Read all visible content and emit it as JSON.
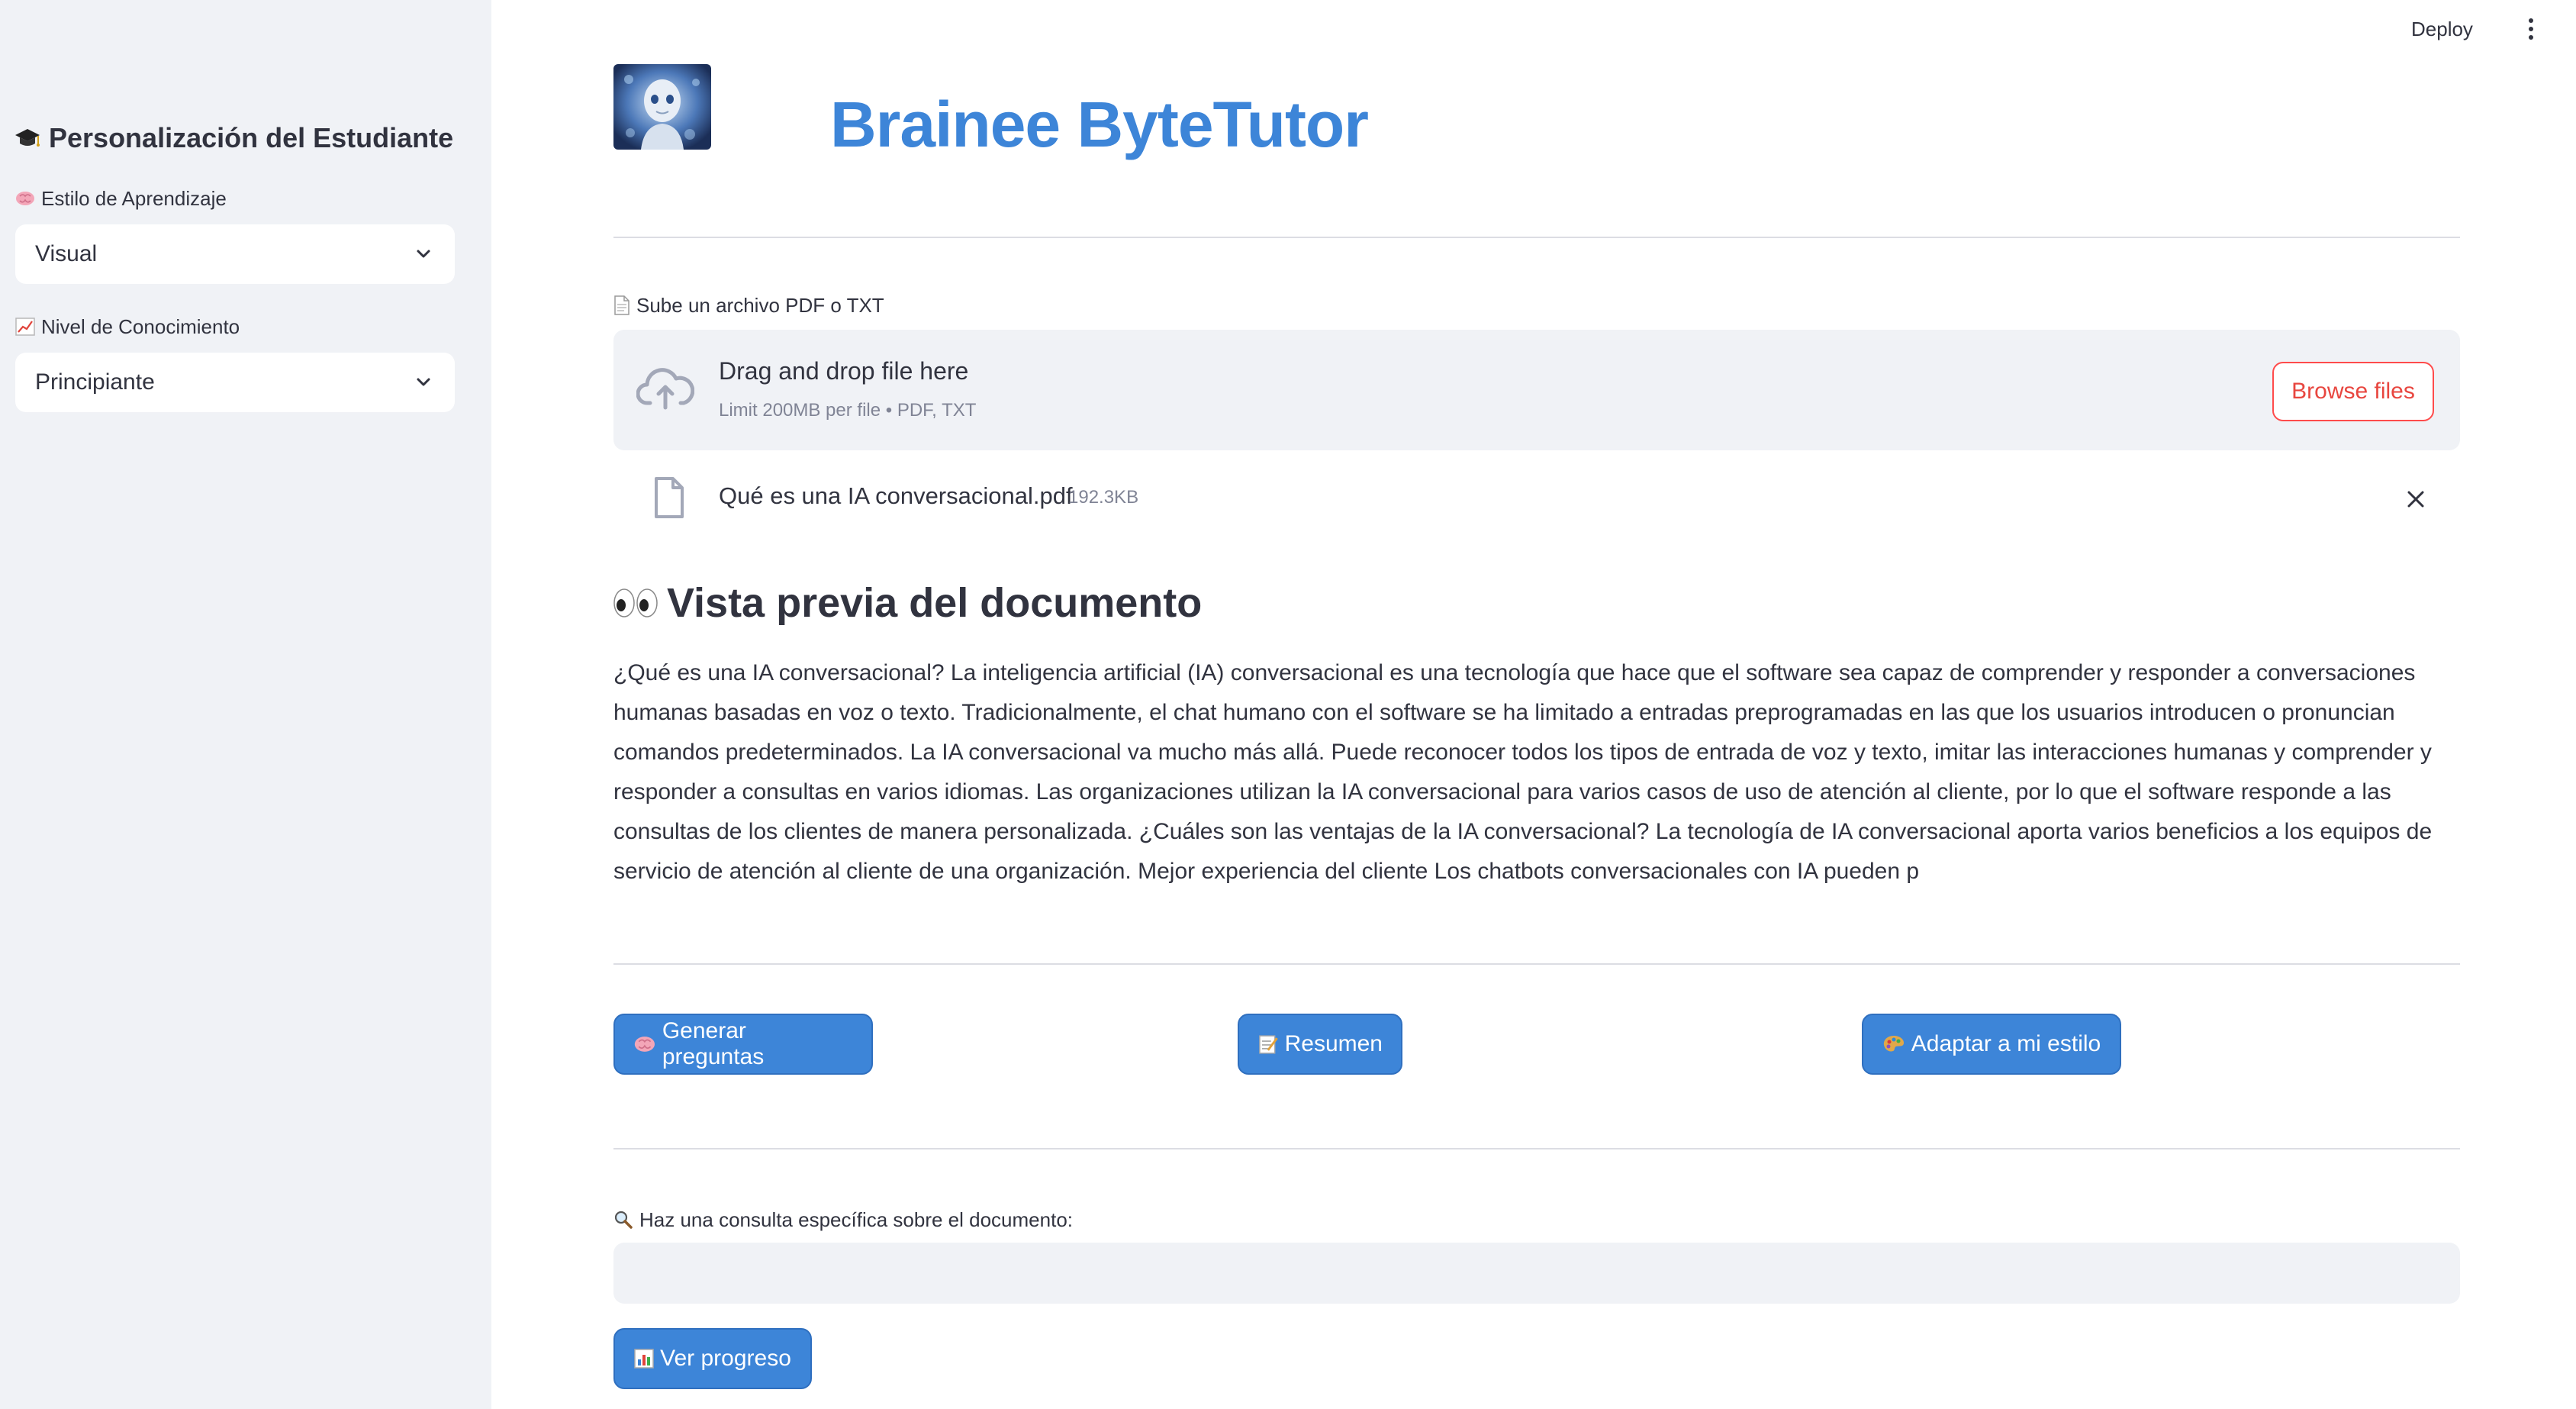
{
  "header": {
    "deploy_label": "Deploy"
  },
  "sidebar": {
    "title": "Personalización del Estudiante",
    "title_icon": "graduation-cap-icon",
    "learning_style": {
      "label": "Estilo de Aprendizaje",
      "icon": "brain-icon",
      "value": "Visual"
    },
    "knowledge_level": {
      "label": "Nivel de Conocimiento",
      "icon": "chart-increasing-icon",
      "value": "Principiante"
    }
  },
  "main": {
    "app_title": "Brainee ByteTutor",
    "upload": {
      "label": "Sube un archivo PDF o TXT",
      "icon": "page-icon",
      "drop_text": "Drag and drop file here",
      "limit_text": "Limit 200MB per file • PDF, TXT",
      "browse_label": "Browse files"
    },
    "file": {
      "name": "Qué es una IA conversacional.pdf",
      "size": "192.3KB"
    },
    "preview": {
      "heading": "Vista previa del documento",
      "heading_icon": "eyes-icon",
      "lines": [
        "¿Qué es una IA conversacional? La inteligencia artificial (IA) conversacional es una tecnología que hace que el software sea capaz de comprender y responder a conversaciones",
        "humanas basadas en voz o texto. Tradicionalmente, el chat humano con el software se ha limitado a entradas preprogramadas en las que los usuarios introducen o pronuncian",
        "comandos predeterminados. La IA conversacional va mucho más allá. Puede reconocer todos los tipos de entrada de voz y texto, imitar las interacciones humanas y comprender y",
        "responder a consultas en varios idiomas. Las organizaciones utilizan la IA conversacional para varios casos de uso de atención al cliente, por lo que el software responde a las",
        "consultas de los clientes de manera personalizada. ¿Cuáles son las ventajas de la IA conversacional? La tecnología de IA conversacional aporta varios beneficios a los equipos de",
        "servicio de atención al cliente de una organización. Mejor experiencia del cliente Los chatbots conversacionales con IA pueden p"
      ]
    },
    "actions": {
      "generate_label": "Generar preguntas",
      "summary_label": "Resumen",
      "adapt_label": "Adaptar a mi estilo"
    },
    "query": {
      "label": "Haz una consulta específica sobre el documento:",
      "value": "",
      "placeholder": ""
    },
    "progress_label": "Ver progreso"
  }
}
